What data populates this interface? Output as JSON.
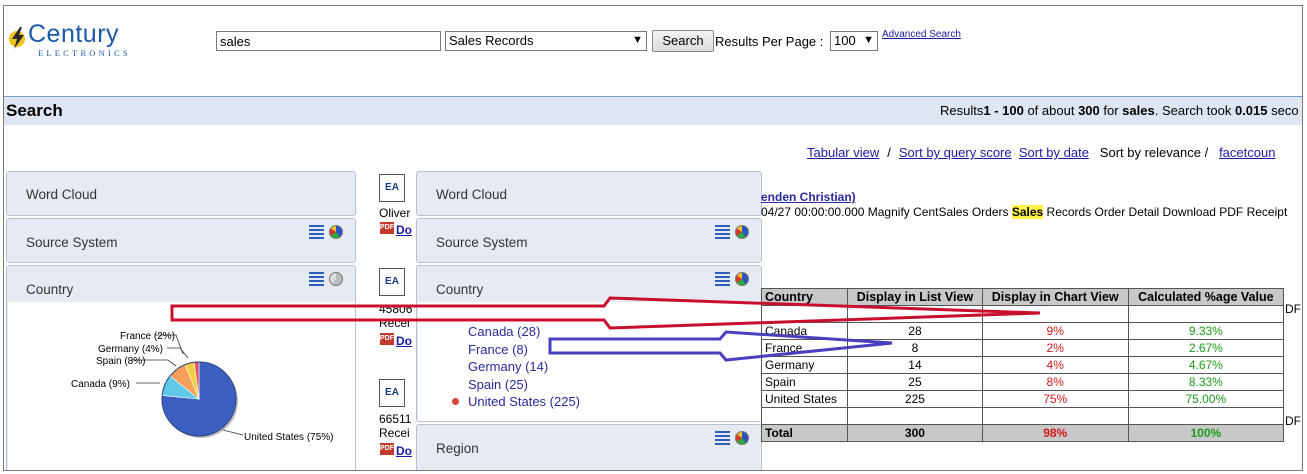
{
  "logo": {
    "word": "Century",
    "sub": "ELECTRONICS"
  },
  "search": {
    "query": "sales",
    "source": "Sales Records",
    "button": "Search",
    "rpp_label": "Results Per Page :",
    "rpp_value": "100",
    "advanced": "Advanced Search"
  },
  "section": {
    "title": "Search"
  },
  "results": {
    "prefix": "Results",
    "range": "1 - 100",
    "of_about": " of about ",
    "total": "300",
    "for": " for ",
    "term": "sales",
    "took": ". Search took ",
    "time": "0.015",
    "tail": " seco"
  },
  "sort": {
    "tabular": "Tabular view",
    "sep": "/",
    "score": "Sort by query score",
    "date": "Sort by date",
    "relevance": "Sort by relevance",
    "sep2": "/",
    "facet": "facetcoun"
  },
  "left_panels": {
    "word_cloud": "Word Cloud",
    "source_system": "Source System",
    "country": "Country"
  },
  "pie_labels": {
    "france": "France (2%)",
    "germany": "Germany (4%)",
    "spain": "Spain (8%)",
    "canada": "Canada (9%)",
    "us": "United States (75%)"
  },
  "mid": {
    "doc_label": "EA",
    "pdf_label": "PDF",
    "r1_name": "Oliver",
    "r1_link": "Do",
    "r2_num": "45806",
    "r2_sub": "Recei",
    "r2_link": "Do",
    "r3_num": "66511",
    "r3_sub": "Recei",
    "r3_link": "Do"
  },
  "right_panels": {
    "word_cloud": "Word Cloud",
    "source_system": "Source System",
    "country": "Country",
    "region": "Region"
  },
  "facets": [
    {
      "label": "Canada (28)"
    },
    {
      "label": "France (8)"
    },
    {
      "label": "Germany (14)"
    },
    {
      "label": "Spain (25)"
    },
    {
      "label": "United States (225)"
    }
  ],
  "result": {
    "title": "enden Christian)",
    "line_pre": "04/27 00:00:00.000 Magnify CentSales Orders ",
    "line_hl": "Sales",
    "line_post": " Records Order Detail Download PDF Receipt"
  },
  "table": {
    "headers": [
      "Country",
      "Display in List View",
      "Display in Chart View",
      "Calculated %age Value"
    ],
    "rows": [
      {
        "country": "Canada",
        "list": "28",
        "chart": "9%",
        "calc": "9.33%"
      },
      {
        "country": "France",
        "list": "8",
        "chart": "2%",
        "calc": "2.67%"
      },
      {
        "country": "Germany",
        "list": "14",
        "chart": "4%",
        "calc": "4.67%"
      },
      {
        "country": "Spain",
        "list": "25",
        "chart": "8%",
        "calc": "8.33%"
      },
      {
        "country": "United States",
        "list": "225",
        "chart": "75%",
        "calc": "75.00%"
      }
    ],
    "total": {
      "label": "Total",
      "list": "300",
      "chart": "98%",
      "calc": "100%"
    },
    "cut1": "DF",
    "cut2": "DF"
  },
  "colors": {
    "arrow_red": "#c8102e",
    "arrow_blue": "#4a3fbf",
    "pie_us": "#3a5fc0",
    "pie_canada": "#5ec8e6",
    "pie_spain": "#f5a05a",
    "pie_germany": "#f0d040",
    "pie_france": "#e0506a"
  }
}
